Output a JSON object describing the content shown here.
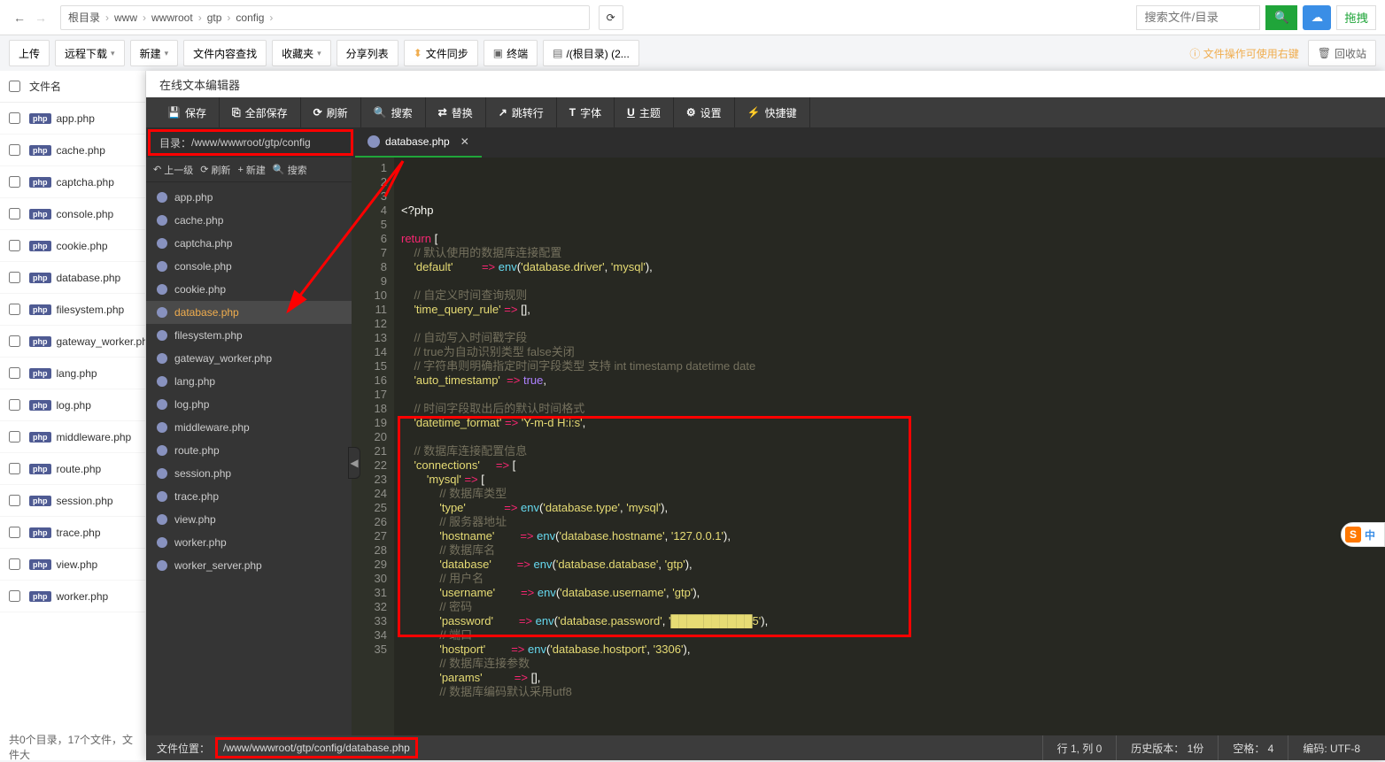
{
  "breadcrumb": {
    "root": "根目录",
    "parts": [
      "www",
      "wwwroot",
      "gtp",
      "config"
    ]
  },
  "search": {
    "placeholder": "搜索文件/目录",
    "grip": "拖拽"
  },
  "toolbar": {
    "upload": "上传",
    "remote": "远程下载",
    "new": "新建",
    "content_search": "文件内容查找",
    "favorites": "收藏夹",
    "share": "分享列表",
    "sync": "文件同步",
    "terminal": "终端",
    "root_path": "/(根目录) (2...",
    "hint": "文件操作可使用右键",
    "recycle": "回收站"
  },
  "file_panel": {
    "header": "文件名",
    "files": [
      "app.php",
      "cache.php",
      "captcha.php",
      "console.php",
      "cookie.php",
      "database.php",
      "filesystem.php",
      "gateway_worker.php",
      "lang.php",
      "log.php",
      "middleware.php",
      "route.php",
      "session.php",
      "trace.php",
      "view.php",
      "worker.php"
    ],
    "status": "共0个目录，17个文件，文件大"
  },
  "editor": {
    "title": "在线文本编辑器",
    "toolbar": {
      "save": "保存",
      "save_all": "全部保存",
      "refresh": "刷新",
      "search": "搜索",
      "replace": "替换",
      "goto": "跳转行",
      "font": "字体",
      "theme": "主题",
      "settings": "设置",
      "shortcut": "快捷键"
    },
    "path_label": "目录：",
    "path_value": "/www/wwwroot/gtp/config",
    "tab_name": "database.php",
    "tree_toolbar": {
      "up": "上一级",
      "refresh": "刷新",
      "new": "新建",
      "search": "搜索"
    },
    "tree_files": [
      "app.php",
      "cache.php",
      "captcha.php",
      "console.php",
      "cookie.php",
      "database.php",
      "filesystem.php",
      "gateway_worker.php",
      "lang.php",
      "log.php",
      "middleware.php",
      "route.php",
      "session.php",
      "trace.php",
      "view.php",
      "worker.php",
      "worker_server.php"
    ],
    "tree_active": "database.php",
    "status": {
      "path_label": "文件位置：",
      "path_value": "/www/wwwroot/gtp/config/database.php",
      "pos": "行 1, 列 0",
      "history": "历史版本： 1份",
      "spaces": "空格： 4",
      "encoding": "编码: UTF-8"
    }
  },
  "code": {
    "line_start": 1,
    "line_end": 35,
    "lines": [
      {
        "n": 1,
        "html": "<span class='tok-pn'>&lt;?php</span>"
      },
      {
        "n": 2,
        "html": ""
      },
      {
        "n": 3,
        "html": "<span class='tok-kw'>return</span> <span class='tok-pn'>[</span>"
      },
      {
        "n": 4,
        "html": "    <span class='tok-cm'>// 默认使用的数据库连接配置</span>"
      },
      {
        "n": 5,
        "html": "    <span class='tok-str'>'default'</span>         <span class='tok-op'>=&gt;</span> <span class='tok-fn'>env</span>(<span class='tok-str'>'database.driver'</span>, <span class='tok-str'>'mysql'</span>),"
      },
      {
        "n": 6,
        "html": ""
      },
      {
        "n": 7,
        "html": "    <span class='tok-cm'>// 自定义时间查询规则</span>"
      },
      {
        "n": 8,
        "html": "    <span class='tok-str'>'time_query_rule'</span> <span class='tok-op'>=&gt;</span> [],"
      },
      {
        "n": 9,
        "html": ""
      },
      {
        "n": 10,
        "html": "    <span class='tok-cm'>// 自动写入时间戳字段</span>"
      },
      {
        "n": 11,
        "html": "    <span class='tok-cm'>// true为自动识别类型 false关闭</span>"
      },
      {
        "n": 12,
        "html": "    <span class='tok-cm'>// 字符串则明确指定时间字段类型 支持 int timestamp datetime date</span>"
      },
      {
        "n": 13,
        "html": "    <span class='tok-str'>'auto_timestamp'</span>  <span class='tok-op'>=&gt;</span> <span class='tok-bool'>true</span>,"
      },
      {
        "n": 14,
        "html": ""
      },
      {
        "n": 15,
        "html": "    <span class='tok-cm'>// 时间字段取出后的默认时间格式</span>"
      },
      {
        "n": 16,
        "html": "    <span class='tok-str'>'datetime_format'</span> <span class='tok-op'>=&gt;</span> <span class='tok-str'>'Y-m-d H:i:s'</span>,"
      },
      {
        "n": 17,
        "html": ""
      },
      {
        "n": 18,
        "html": "    <span class='tok-cm'>// 数据库连接配置信息</span>"
      },
      {
        "n": 19,
        "html": "    <span class='tok-str'>'connections'</span>     <span class='tok-op'>=&gt;</span> ["
      },
      {
        "n": 20,
        "html": "        <span class='tok-str'>'mysql'</span> <span class='tok-op'>=&gt;</span> ["
      },
      {
        "n": 21,
        "html": "            <span class='tok-cm'>// 数据库类型</span>"
      },
      {
        "n": 22,
        "html": "            <span class='tok-str'>'type'</span>            <span class='tok-op'>=&gt;</span> <span class='tok-fn'>env</span>(<span class='tok-str'>'database.type'</span>, <span class='tok-str'>'mysql'</span>),"
      },
      {
        "n": 23,
        "html": "            <span class='tok-cm'>// 服务器地址</span>"
      },
      {
        "n": 24,
        "html": "            <span class='tok-str'>'hostname'</span>        <span class='tok-op'>=&gt;</span> <span class='tok-fn'>env</span>(<span class='tok-str'>'database.hostname'</span>, <span class='tok-str'>'127.0.0.1'</span>),"
      },
      {
        "n": 25,
        "html": "            <span class='tok-cm'>// 数据库名</span>"
      },
      {
        "n": 26,
        "html": "            <span class='tok-str'>'database'</span>        <span class='tok-op'>=&gt;</span> <span class='tok-fn'>env</span>(<span class='tok-str'>'database.database'</span>, <span class='tok-str'>'gtp'</span>),"
      },
      {
        "n": 27,
        "html": "            <span class='tok-cm'>// 用户名</span>"
      },
      {
        "n": 28,
        "html": "            <span class='tok-str'>'username'</span>        <span class='tok-op'>=&gt;</span> <span class='tok-fn'>env</span>(<span class='tok-str'>'database.username'</span>, <span class='tok-str'>'gtp'</span>),"
      },
      {
        "n": 29,
        "html": "            <span class='tok-cm'>// 密码</span>"
      },
      {
        "n": 30,
        "html": "            <span class='tok-str'>'password'</span>        <span class='tok-op'>=&gt;</span> <span class='tok-fn'>env</span>(<span class='tok-str'>'database.password'</span>, <span class='tok-str'>'██████████5'</span>),"
      },
      {
        "n": 31,
        "html": "            <span class='tok-cm'>// 端口</span>"
      },
      {
        "n": 32,
        "html": "            <span class='tok-str'>'hostport'</span>        <span class='tok-op'>=&gt;</span> <span class='tok-fn'>env</span>(<span class='tok-str'>'database.hostport'</span>, <span class='tok-str'>'3306'</span>),"
      },
      {
        "n": 33,
        "html": "            <span class='tok-cm'>// 数据库连接参数</span>"
      },
      {
        "n": 34,
        "html": "            <span class='tok-str'>'params'</span>          <span class='tok-op'>=&gt;</span> [],"
      },
      {
        "n": 35,
        "html": "            <span class='tok-cm'>// 数据库编码默认采用utf8</span>"
      }
    ]
  },
  "sogou": {
    "text": "中"
  }
}
